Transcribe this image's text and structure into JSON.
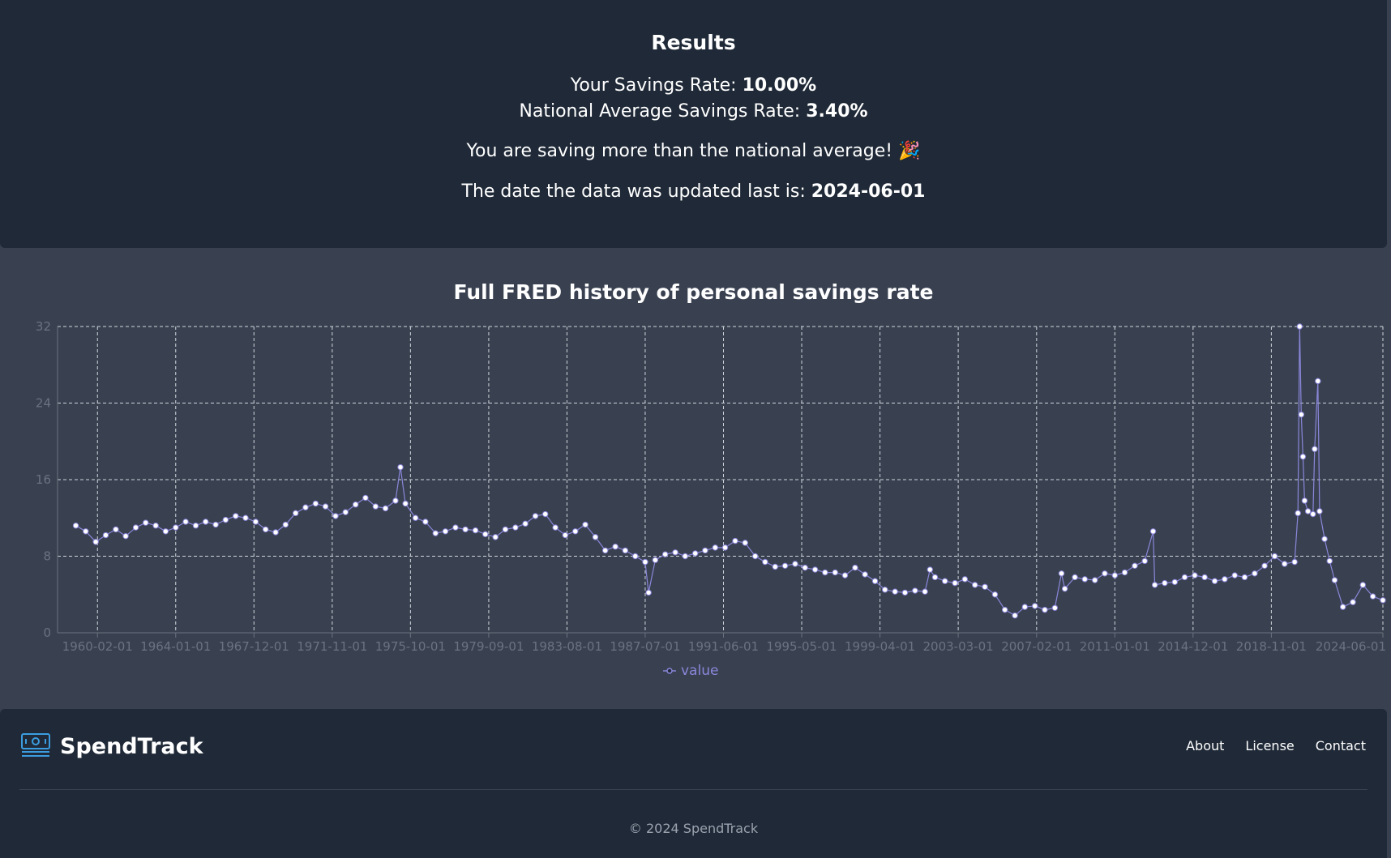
{
  "results": {
    "title": "Results",
    "your_rate_label": "Your Savings Rate:",
    "your_rate_value": "10.00%",
    "national_rate_label": "National Average Savings Rate:",
    "national_rate_value": "3.40%",
    "message": "You are saving more than the national average! 🎉",
    "updated_label": "The date the data was updated last is:",
    "updated_value": "2024-06-01"
  },
  "chart": {
    "title": "Full FRED history of personal savings rate",
    "legend_label": "value"
  },
  "chart_data": {
    "type": "line",
    "title": "Full FRED history of personal savings rate",
    "xlabel": "",
    "ylabel": "",
    "ylim": [
      0,
      32
    ],
    "yticks": [
      0,
      8,
      16,
      24,
      32
    ],
    "xticks": [
      "1960-02-01",
      "1964-01-01",
      "1967-12-01",
      "1971-11-01",
      "1975-10-01",
      "1979-09-01",
      "1983-08-01",
      "1987-07-01",
      "1991-06-01",
      "1995-05-01",
      "1999-04-01",
      "2003-03-01",
      "2007-02-01",
      "2011-01-01",
      "2014-12-01",
      "2018-11-01",
      "2024-06-01"
    ],
    "grid": true,
    "legend": "bottom-center",
    "series": [
      {
        "name": "value",
        "color": "#8b86d9",
        "points": [
          [
            "1959-01-01",
            11.2
          ],
          [
            "1959-07-01",
            10.6
          ],
          [
            "1960-01-01",
            9.5
          ],
          [
            "1960-07-01",
            10.2
          ],
          [
            "1961-01-01",
            10.8
          ],
          [
            "1961-07-01",
            10.1
          ],
          [
            "1962-01-01",
            11.0
          ],
          [
            "1962-07-01",
            11.5
          ],
          [
            "1963-01-01",
            11.2
          ],
          [
            "1963-07-01",
            10.6
          ],
          [
            "1964-01-01",
            11.0
          ],
          [
            "1964-07-01",
            11.6
          ],
          [
            "1965-01-01",
            11.2
          ],
          [
            "1965-07-01",
            11.6
          ],
          [
            "1966-01-01",
            11.3
          ],
          [
            "1966-07-01",
            11.8
          ],
          [
            "1967-01-01",
            12.2
          ],
          [
            "1967-07-01",
            12.0
          ],
          [
            "1968-01-01",
            11.6
          ],
          [
            "1968-07-01",
            10.8
          ],
          [
            "1969-01-01",
            10.5
          ],
          [
            "1969-07-01",
            11.3
          ],
          [
            "1970-01-01",
            12.5
          ],
          [
            "1970-07-01",
            13.1
          ],
          [
            "1971-01-01",
            13.5
          ],
          [
            "1971-07-01",
            13.2
          ],
          [
            "1972-01-01",
            12.2
          ],
          [
            "1972-07-01",
            12.6
          ],
          [
            "1973-01-01",
            13.4
          ],
          [
            "1973-07-01",
            14.1
          ],
          [
            "1974-01-01",
            13.2
          ],
          [
            "1974-07-01",
            13.0
          ],
          [
            "1975-01-01",
            13.8
          ],
          [
            "1975-04-01",
            17.3
          ],
          [
            "1975-07-01",
            13.5
          ],
          [
            "1976-01-01",
            12.0
          ],
          [
            "1976-07-01",
            11.6
          ],
          [
            "1977-01-01",
            10.4
          ],
          [
            "1977-07-01",
            10.6
          ],
          [
            "1978-01-01",
            11.0
          ],
          [
            "1978-07-01",
            10.8
          ],
          [
            "1979-01-01",
            10.7
          ],
          [
            "1979-07-01",
            10.3
          ],
          [
            "1980-01-01",
            10.0
          ],
          [
            "1980-07-01",
            10.8
          ],
          [
            "1981-01-01",
            11.0
          ],
          [
            "1981-07-01",
            11.4
          ],
          [
            "1982-01-01",
            12.2
          ],
          [
            "1982-07-01",
            12.4
          ],
          [
            "1983-01-01",
            11.0
          ],
          [
            "1983-07-01",
            10.2
          ],
          [
            "1984-01-01",
            10.6
          ],
          [
            "1984-07-01",
            11.3
          ],
          [
            "1985-01-01",
            10.0
          ],
          [
            "1985-07-01",
            8.6
          ],
          [
            "1986-01-01",
            9.0
          ],
          [
            "1986-07-01",
            8.6
          ],
          [
            "1987-01-01",
            8.0
          ],
          [
            "1987-07-01",
            7.4
          ],
          [
            "1987-09-01",
            4.2
          ],
          [
            "1988-01-01",
            7.6
          ],
          [
            "1988-07-01",
            8.2
          ],
          [
            "1989-01-01",
            8.4
          ],
          [
            "1989-07-01",
            8.0
          ],
          [
            "1990-01-01",
            8.3
          ],
          [
            "1990-07-01",
            8.6
          ],
          [
            "1991-01-01",
            8.9
          ],
          [
            "1991-07-01",
            8.9
          ],
          [
            "1992-01-01",
            9.6
          ],
          [
            "1992-07-01",
            9.4
          ],
          [
            "1993-01-01",
            8.0
          ],
          [
            "1993-07-01",
            7.4
          ],
          [
            "1994-01-01",
            6.9
          ],
          [
            "1994-07-01",
            7.0
          ],
          [
            "1995-01-01",
            7.2
          ],
          [
            "1995-07-01",
            6.8
          ],
          [
            "1996-01-01",
            6.6
          ],
          [
            "1996-07-01",
            6.3
          ],
          [
            "1997-01-01",
            6.3
          ],
          [
            "1997-07-01",
            6.0
          ],
          [
            "1998-01-01",
            6.8
          ],
          [
            "1998-07-01",
            6.1
          ],
          [
            "1999-01-01",
            5.4
          ],
          [
            "1999-07-01",
            4.5
          ],
          [
            "2000-01-01",
            4.3
          ],
          [
            "2000-07-01",
            4.2
          ],
          [
            "2001-01-01",
            4.4
          ],
          [
            "2001-07-01",
            4.3
          ],
          [
            "2001-10-01",
            6.6
          ],
          [
            "2002-01-01",
            5.8
          ],
          [
            "2002-07-01",
            5.4
          ],
          [
            "2003-01-01",
            5.2
          ],
          [
            "2003-07-01",
            5.6
          ],
          [
            "2004-01-01",
            5.0
          ],
          [
            "2004-07-01",
            4.8
          ],
          [
            "2005-01-01",
            4.0
          ],
          [
            "2005-07-01",
            2.4
          ],
          [
            "2006-01-01",
            1.8
          ],
          [
            "2006-07-01",
            2.7
          ],
          [
            "2007-01-01",
            2.8
          ],
          [
            "2007-07-01",
            2.4
          ],
          [
            "2008-01-01",
            2.6
          ],
          [
            "2008-05-01",
            6.2
          ],
          [
            "2008-07-01",
            4.6
          ],
          [
            "2009-01-01",
            5.8
          ],
          [
            "2009-07-01",
            5.6
          ],
          [
            "2010-01-01",
            5.5
          ],
          [
            "2010-07-01",
            6.2
          ],
          [
            "2011-01-01",
            6.0
          ],
          [
            "2011-07-01",
            6.3
          ],
          [
            "2012-01-01",
            7.0
          ],
          [
            "2012-07-01",
            7.5
          ],
          [
            "2012-12-01",
            10.6
          ],
          [
            "2013-01-01",
            5.0
          ],
          [
            "2013-07-01",
            5.2
          ],
          [
            "2014-01-01",
            5.3
          ],
          [
            "2014-07-01",
            5.8
          ],
          [
            "2015-01-01",
            6.0
          ],
          [
            "2015-07-01",
            5.8
          ],
          [
            "2016-01-01",
            5.4
          ],
          [
            "2016-07-01",
            5.6
          ],
          [
            "2017-01-01",
            6.0
          ],
          [
            "2017-07-01",
            5.8
          ],
          [
            "2018-01-01",
            6.2
          ],
          [
            "2018-07-01",
            7.0
          ],
          [
            "2019-01-01",
            8.0
          ],
          [
            "2019-07-01",
            7.2
          ],
          [
            "2020-01-01",
            7.4
          ],
          [
            "2020-03-01",
            12.5
          ],
          [
            "2020-04-01",
            32.0
          ],
          [
            "2020-05-01",
            22.8
          ],
          [
            "2020-06-01",
            18.4
          ],
          [
            "2020-07-01",
            13.8
          ],
          [
            "2020-09-01",
            12.7
          ],
          [
            "2020-12-01",
            12.4
          ],
          [
            "2021-01-01",
            19.2
          ],
          [
            "2021-03-01",
            26.3
          ],
          [
            "2021-04-01",
            12.7
          ],
          [
            "2021-07-01",
            9.8
          ],
          [
            "2021-10-01",
            7.5
          ],
          [
            "2022-01-01",
            5.5
          ],
          [
            "2022-06-01",
            2.7
          ],
          [
            "2022-12-01",
            3.2
          ],
          [
            "2023-06-01",
            5.0
          ],
          [
            "2023-12-01",
            3.8
          ],
          [
            "2024-06-01",
            3.4
          ]
        ]
      }
    ]
  },
  "footer": {
    "brand": "SpendTrack",
    "nav": [
      "About",
      "License",
      "Contact"
    ],
    "copyright": "© 2024 SpendTrack"
  }
}
